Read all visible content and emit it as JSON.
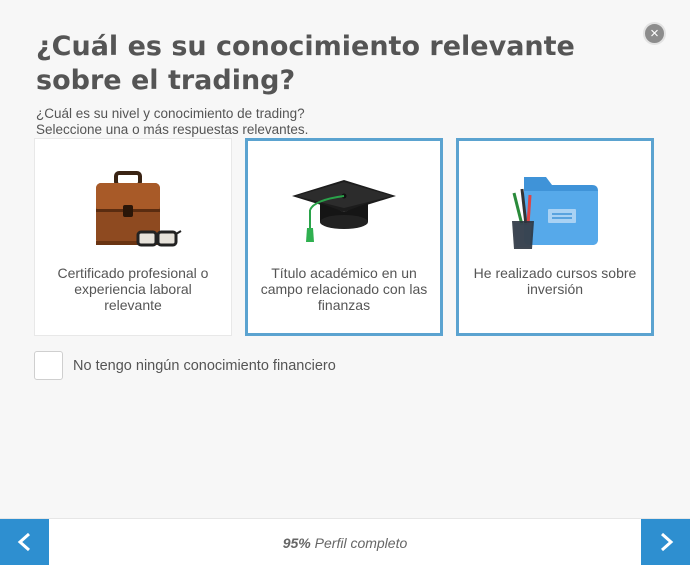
{
  "dialog": {
    "title": "¿Cuál es su conocimiento relevante sobre el trading?",
    "subtitle_line1": "¿Cuál es su nivel y conocimiento de trading?",
    "subtitle_line2": "Seleccione una o más respuestas relevantes.",
    "close_symbol": "×"
  },
  "options": [
    {
      "label": "Certificado profesional o experiencia laboral relevante",
      "icon": "briefcase-glasses-icon",
      "selected": false
    },
    {
      "label": "Título académico en un campo relacionado con las finanzas",
      "icon": "graduation-cap-icon",
      "selected": true
    },
    {
      "label": "He realizado cursos sobre inversión",
      "icon": "folder-pencils-icon",
      "selected": true
    }
  ],
  "no_knowledge": {
    "label": "No tengo ningún conocimiento financiero",
    "checked": false
  },
  "footer": {
    "progress_percent": "95%",
    "progress_text": "Perfil completo"
  },
  "colors": {
    "accent": "#2e8fd0",
    "selected_border": "#5ba3d0"
  }
}
